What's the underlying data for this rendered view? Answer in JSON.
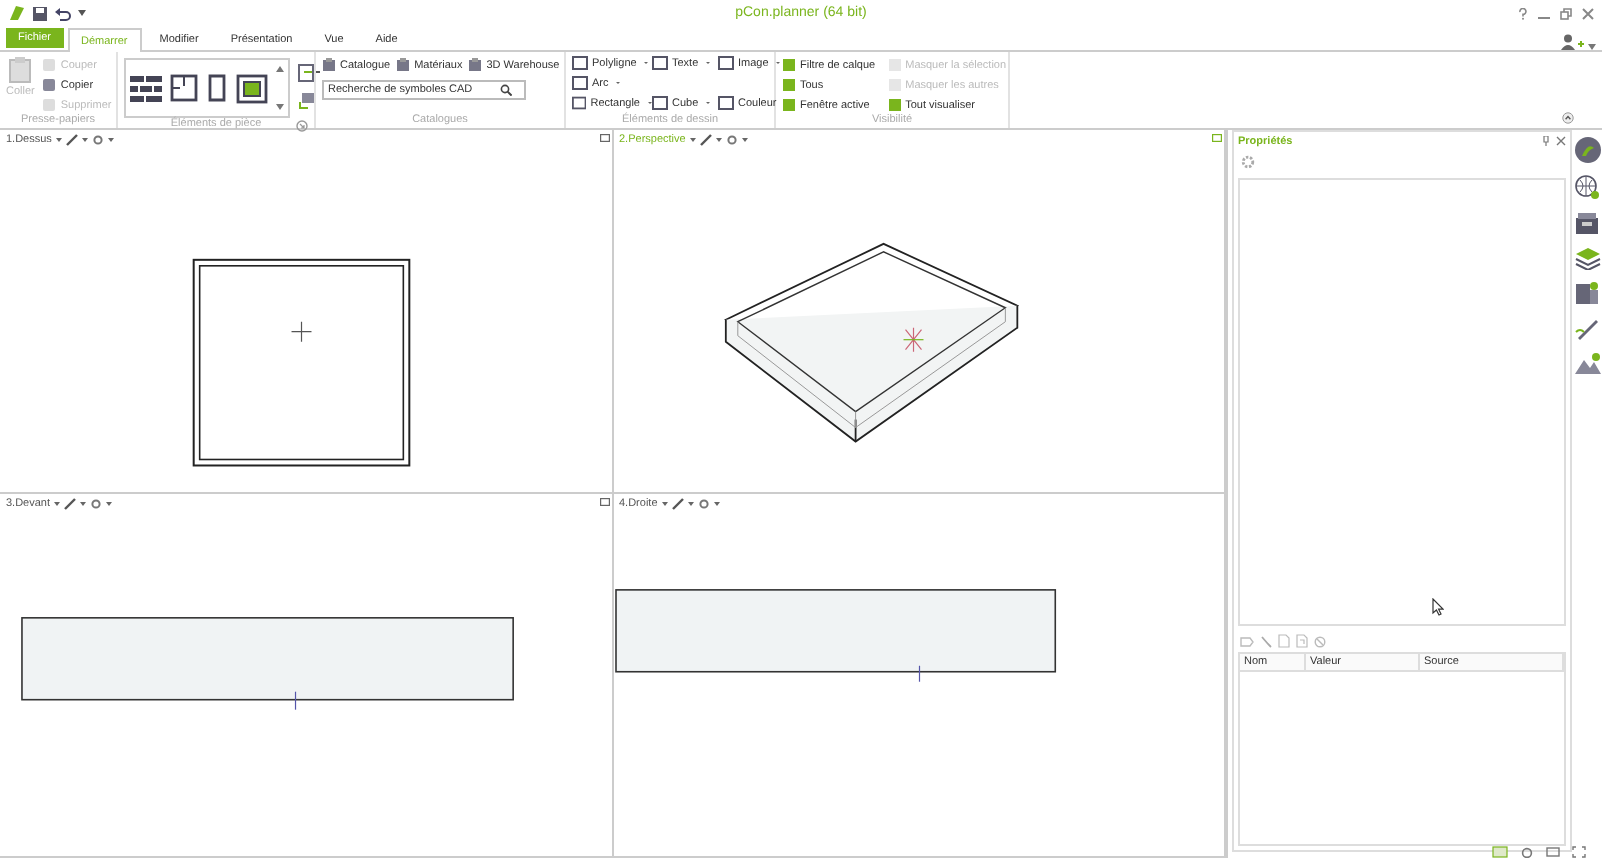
{
  "window": {
    "title": "pCon.planner (64 bit)"
  },
  "tabs": [
    {
      "label": "Fichier",
      "kind": "file",
      "selected": false
    },
    {
      "label": "Démarrer",
      "kind": "tab",
      "selected": true
    },
    {
      "label": "Modifier",
      "kind": "tab",
      "selected": false
    },
    {
      "label": "Présentation",
      "kind": "tab",
      "selected": false
    },
    {
      "label": "Vue",
      "kind": "tab",
      "selected": false
    },
    {
      "label": "Aide",
      "kind": "tab",
      "selected": false
    }
  ],
  "clipboard": {
    "title": "Presse-papiers",
    "paste": {
      "label": "Coller",
      "disabled": true
    },
    "actions": [
      {
        "label": "Couper",
        "disabled": true
      },
      {
        "label": "Copier",
        "disabled": false
      },
      {
        "label": "Supprimer",
        "disabled": true
      }
    ]
  },
  "room_elements": {
    "title": "Éléments de pièce"
  },
  "catalogs": {
    "title": "Catalogues",
    "links": [
      "Catalogue",
      "Matériaux",
      "3D Warehouse"
    ],
    "search": {
      "placeholder": "Recherche de symboles CAD"
    }
  },
  "drawing": {
    "title": "Éléments de dessin",
    "rows": [
      [
        "Polyligne",
        "Texte",
        "Image"
      ],
      [
        "Arc"
      ],
      [
        "Rectangle",
        "Cube",
        "Couleur"
      ]
    ]
  },
  "visibility": {
    "title": "Visibilité",
    "items": [
      {
        "label": "Filtre de calque",
        "disabled": false
      },
      {
        "label": "Tous",
        "disabled": false
      },
      {
        "label": "Fenêtre active",
        "disabled": false
      },
      {
        "label": "Masquer la sélection",
        "disabled": true
      },
      {
        "label": "Masquer les autres",
        "disabled": true
      },
      {
        "label": "Tout visualiser",
        "disabled": false
      }
    ]
  },
  "viewports": [
    {
      "label": "1.Dessus",
      "kind": "top",
      "active": false
    },
    {
      "label": "2.Perspective",
      "kind": "perspective",
      "active": true
    },
    {
      "label": "3.Devant",
      "kind": "front",
      "active": false
    },
    {
      "label": "4.Droite",
      "kind": "right",
      "active": false
    }
  ],
  "properties": {
    "title": "Propriétés",
    "columns": [
      "Nom",
      "Valeur",
      "Source"
    ]
  }
}
